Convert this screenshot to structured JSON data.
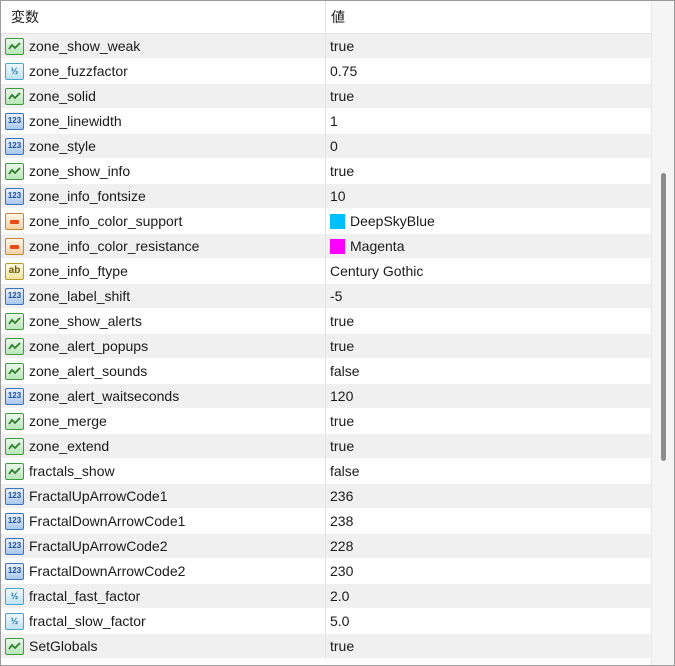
{
  "header": {
    "col_variable": "変数",
    "col_value": "値"
  },
  "rows": [
    {
      "name": "zone_show_weak",
      "value": "true",
      "icon": "boolean-icon"
    },
    {
      "name": "zone_fuzzfactor",
      "value": "0.75",
      "icon": "double-icon"
    },
    {
      "name": "zone_solid",
      "value": "true",
      "icon": "boolean-icon"
    },
    {
      "name": "zone_linewidth",
      "value": "1",
      "icon": "integer-icon"
    },
    {
      "name": "zone_style",
      "value": "0",
      "icon": "integer-icon"
    },
    {
      "name": "zone_show_info",
      "value": "true",
      "icon": "boolean-icon"
    },
    {
      "name": "zone_info_fontsize",
      "value": "10",
      "icon": "integer-icon"
    },
    {
      "name": "zone_info_color_support",
      "value": "DeepSkyBlue",
      "icon": "color-icon",
      "swatch": "#00bfff"
    },
    {
      "name": "zone_info_color_resistance",
      "value": "Magenta",
      "icon": "color-icon",
      "swatch": "#ff00ff"
    },
    {
      "name": "zone_info_ftype",
      "value": "Century Gothic",
      "icon": "string-icon"
    },
    {
      "name": "zone_label_shift",
      "value": "-5",
      "icon": "integer-icon"
    },
    {
      "name": "zone_show_alerts",
      "value": "true",
      "icon": "boolean-icon"
    },
    {
      "name": "zone_alert_popups",
      "value": "true",
      "icon": "boolean-icon"
    },
    {
      "name": "zone_alert_sounds",
      "value": "false",
      "icon": "boolean-icon"
    },
    {
      "name": "zone_alert_waitseconds",
      "value": "120",
      "icon": "integer-icon"
    },
    {
      "name": "zone_merge",
      "value": "true",
      "icon": "boolean-icon"
    },
    {
      "name": "zone_extend",
      "value": "true",
      "icon": "boolean-icon"
    },
    {
      "name": "fractals_show",
      "value": "false",
      "icon": "boolean-icon"
    },
    {
      "name": "FractalUpArrowCode1",
      "value": "236",
      "icon": "integer-icon"
    },
    {
      "name": "FractalDownArrowCode1",
      "value": "238",
      "icon": "integer-icon"
    },
    {
      "name": "FractalUpArrowCode2",
      "value": "228",
      "icon": "integer-icon"
    },
    {
      "name": "FractalDownArrowCode2",
      "value": "230",
      "icon": "integer-icon"
    },
    {
      "name": "fractal_fast_factor",
      "value": "2.0",
      "icon": "double-icon"
    },
    {
      "name": "fractal_slow_factor",
      "value": "5.0",
      "icon": "double-icon"
    },
    {
      "name": "SetGlobals",
      "value": "true",
      "icon": "boolean-icon"
    }
  ],
  "icon_glyphs": {
    "integer-icon": "123",
    "double-icon": "½",
    "string-icon": "ab"
  }
}
